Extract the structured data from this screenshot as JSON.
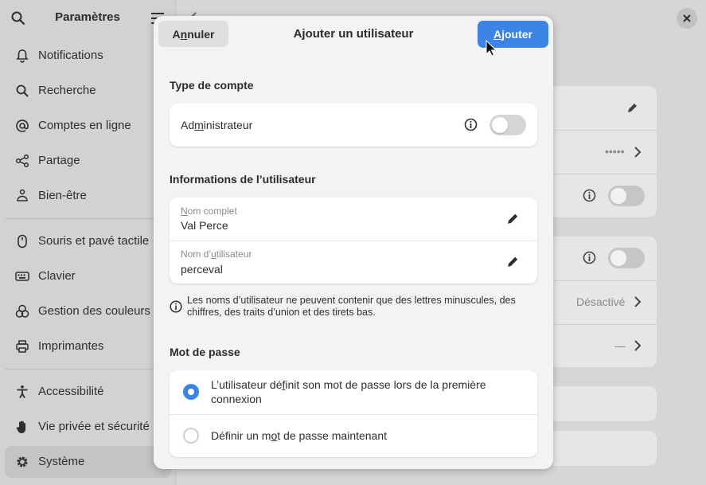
{
  "sidebar": {
    "title": "Paramètres",
    "items": [
      {
        "label": "Notifications"
      },
      {
        "label": "Recherche"
      },
      {
        "label": "Comptes en ligne"
      },
      {
        "label": "Partage"
      },
      {
        "label": "Bien-être"
      },
      {
        "label": "Souris et pavé tactile"
      },
      {
        "label": "Clavier"
      },
      {
        "label": "Gestion des couleurs"
      },
      {
        "label": "Imprimantes"
      },
      {
        "label": "Accessibilité"
      },
      {
        "label": "Vie privée et sécurité"
      },
      {
        "label": "Système"
      }
    ]
  },
  "background": {
    "password_mask": "•••••",
    "status_disabled": "Désactivé",
    "dash_value": "—"
  },
  "dialog": {
    "title": "Ajouter un utilisateur",
    "cancel_pre": "A",
    "cancel_u": "n",
    "cancel_post": "nuler",
    "add_pre": "",
    "add_u": "A",
    "add_post": "jouter",
    "account_type": {
      "heading": "Type de compte",
      "admin_pre": "Ad",
      "admin_u": "m",
      "admin_post": "inistrateur",
      "admin_enabled": false
    },
    "user_info": {
      "heading": "Informations de l’utilisateur",
      "full_name_label_pre": "",
      "full_name_label_u": "N",
      "full_name_label_post": "om complet",
      "full_name_value": "Val Perce",
      "username_label_pre": "Nom d’",
      "username_label_u": "u",
      "username_label_post": "tilisateur",
      "username_value": "perceval",
      "hint": "Les noms d’utilisateur ne peuvent contenir que des lettres minuscules, des chiffres, des traits d’union et des tirets bas."
    },
    "password": {
      "heading": "Mot de passe",
      "option1_pre": "L’utilisateur dé",
      "option1_u": "f",
      "option1_post": "init son mot de passe lors de la première connexion",
      "option2_pre": "Définir un m",
      "option2_u": "o",
      "option2_post": "t de passe maintenant",
      "selected": 1
    }
  },
  "colors": {
    "accent": "#3b84e6"
  }
}
